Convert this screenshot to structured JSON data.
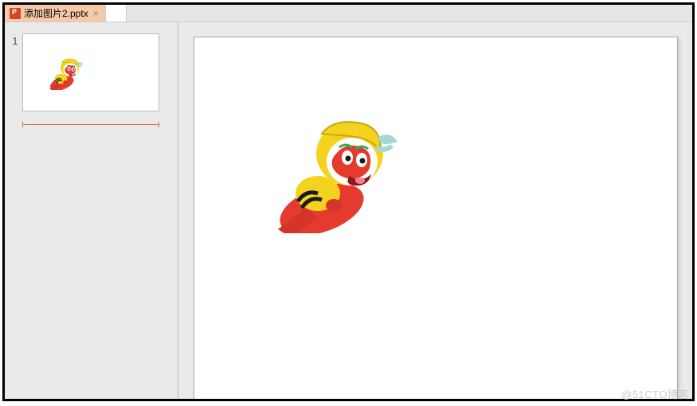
{
  "tabs": {
    "active_filename": "添加图片2.pptx",
    "close_symbol": "×"
  },
  "thumbnails": [
    {
      "number": "1"
    }
  ],
  "image": {
    "name": "monkey-king-cartoon"
  },
  "watermark": "@51CTO博客"
}
